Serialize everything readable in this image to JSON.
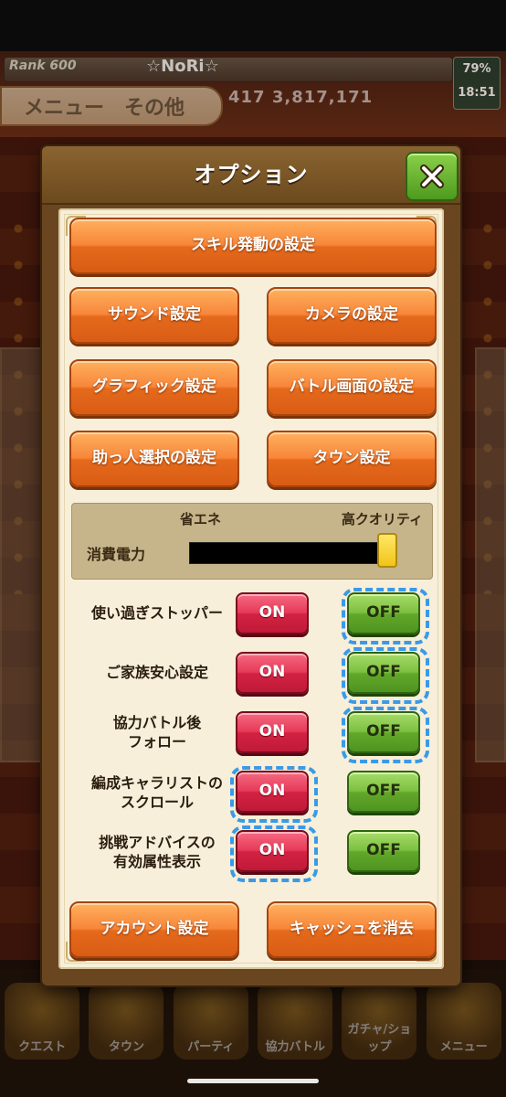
{
  "background": {
    "rank_label": "Rank 600",
    "player_name": "☆NoRi☆",
    "battery": "79%",
    "clock": "18:51",
    "menu_tab": "メニュー　その他",
    "currency_values": "417   3,817,171",
    "bottom_nav": [
      "クエスト",
      "タウン",
      "パーティ",
      "協力バトル",
      "ガチャ/ショップ",
      "メニュー"
    ]
  },
  "dialog": {
    "title": "オプション",
    "close_icon": "close-x-icon",
    "buttons": {
      "skill": "スキル発動の設定",
      "sound": "サウンド設定",
      "camera": "カメラの設定",
      "graphic": "グラフィック設定",
      "battle_screen": "バトル画面の設定",
      "helper": "助っ人選択の設定",
      "town": "タウン設定",
      "account": "アカウント設定",
      "cache": "キャッシュを消去"
    },
    "power": {
      "label": "消費電力",
      "low_label": "省エネ",
      "high_label": "高クオリティ",
      "level": 1.0
    },
    "toggles": [
      {
        "label": "使い過ぎストッパー",
        "on": "ON",
        "off": "OFF",
        "selected": "off"
      },
      {
        "label": "ご家族安心設定",
        "on": "ON",
        "off": "OFF",
        "selected": "off"
      },
      {
        "label": "協力バトル後\nフォロー",
        "on": "ON",
        "off": "OFF",
        "selected": "off"
      },
      {
        "label": "編成キャラリストの\nスクロール",
        "on": "ON",
        "off": "OFF",
        "selected": "on"
      },
      {
        "label": "挑戦アドバイスの\n有効属性表示",
        "on": "ON",
        "off": "OFF",
        "selected": "on"
      }
    ]
  },
  "colors": {
    "orange_button": "#f7863a",
    "on_button": "#e63a58",
    "off_button": "#7cc040",
    "selection_ring": "#3a9ae8"
  }
}
